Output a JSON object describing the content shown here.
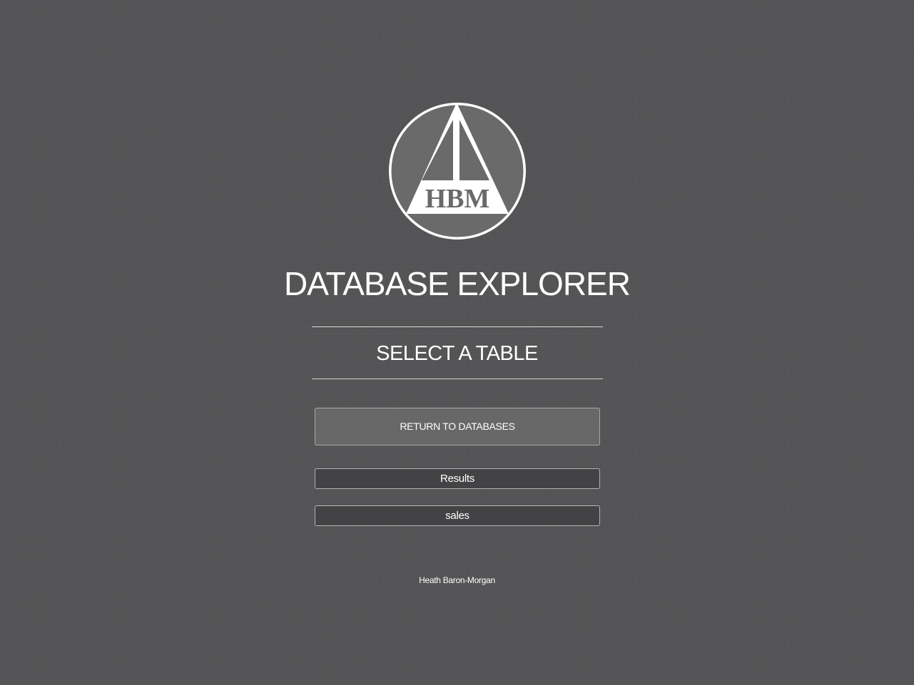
{
  "logo": {
    "text": "HBM",
    "colors": {
      "circle_fill": "#6a6a6a",
      "ring": "#ffffff",
      "triangle": "#ffffff",
      "lettering": "#6a6a6a"
    }
  },
  "header": {
    "title": "DATABASE EXPLORER",
    "subtitle": "SELECT A TABLE"
  },
  "actions": {
    "return_label": "RETURN TO DATABASES"
  },
  "tables": [
    {
      "label": "Results"
    },
    {
      "label": "sales"
    }
  ],
  "footer": {
    "author": "Heath Baron-Morgan"
  },
  "theme": {
    "background": "#545456",
    "button_dark": "#434345",
    "text": "#ffffff"
  }
}
